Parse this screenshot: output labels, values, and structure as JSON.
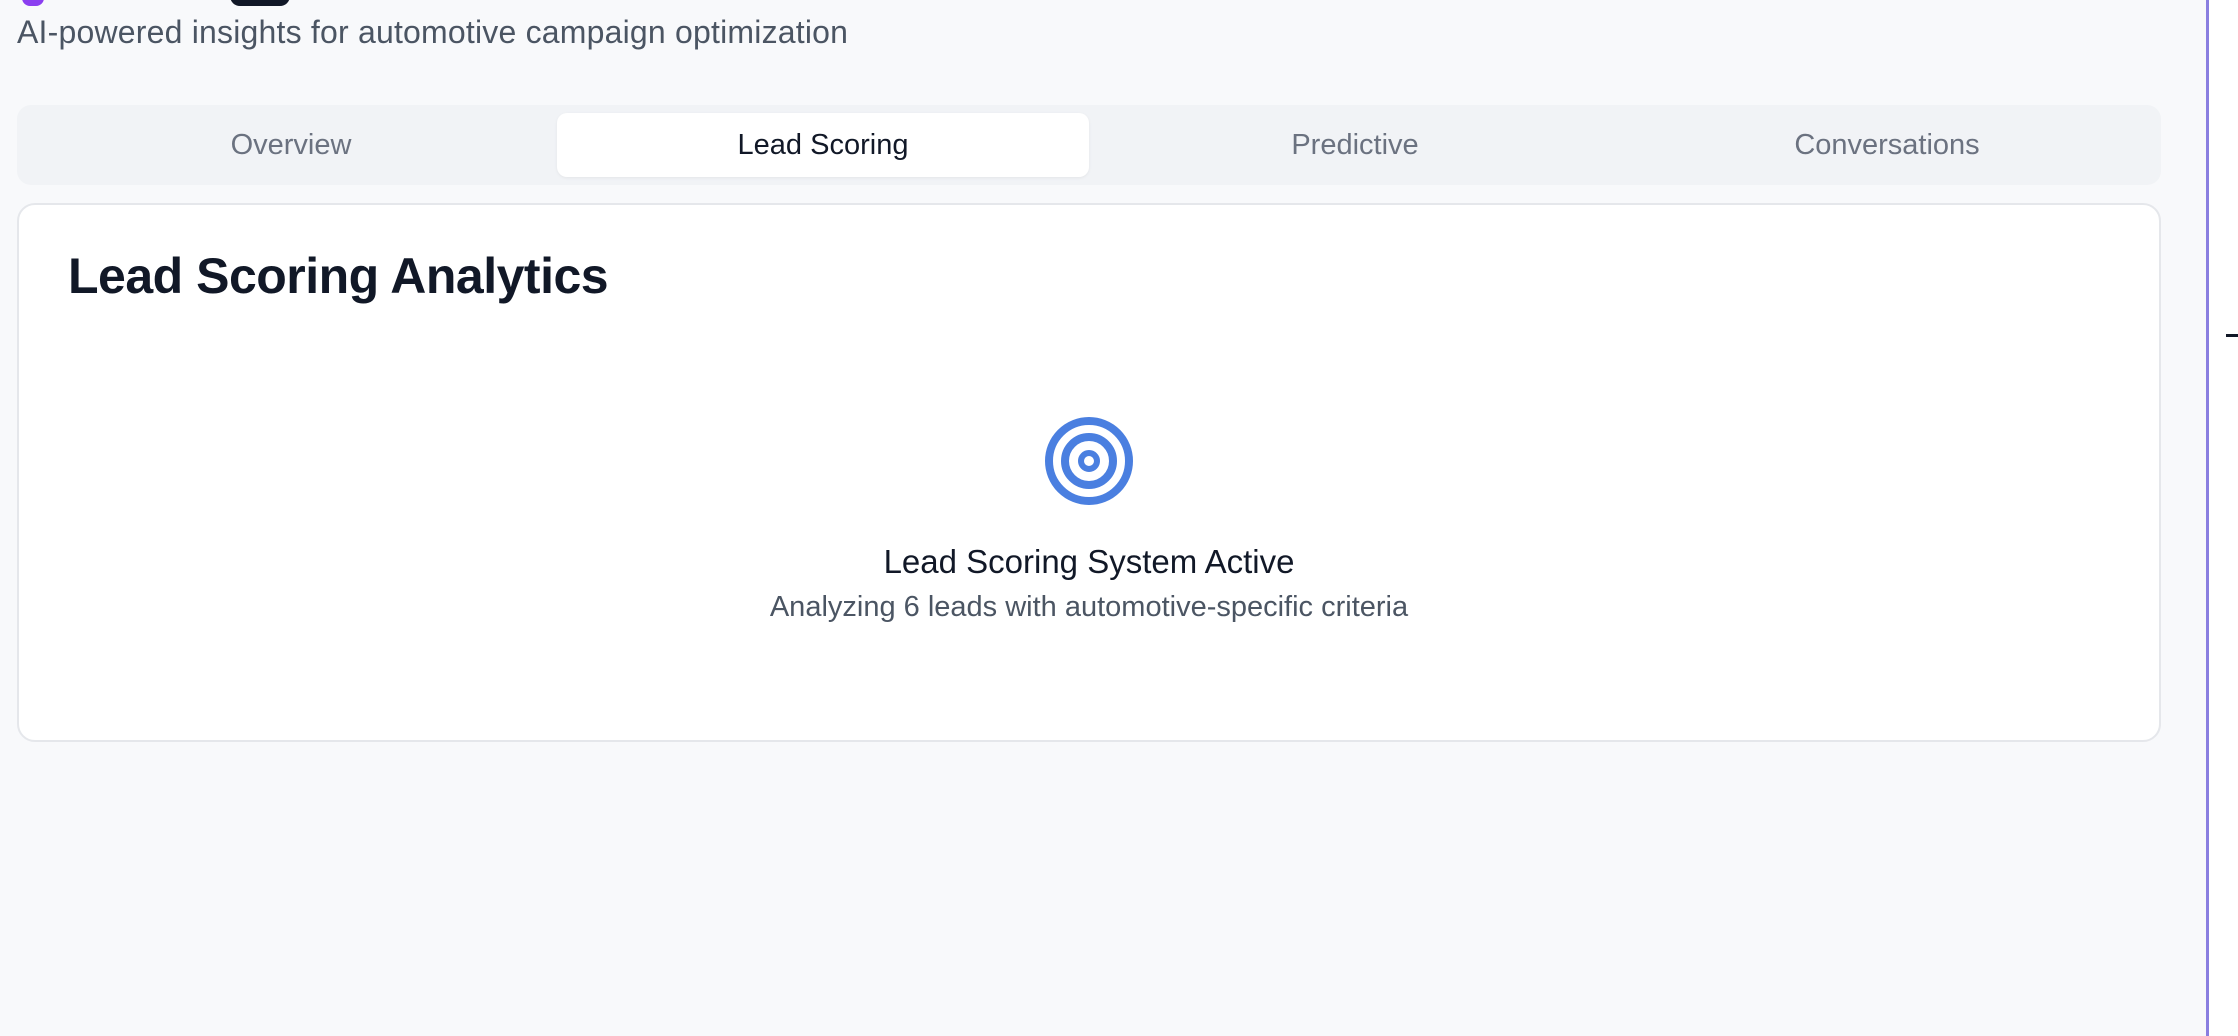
{
  "header": {
    "subtitle": "AI-powered insights for automotive campaign optimization"
  },
  "tabs": [
    {
      "label": "Overview",
      "active": false
    },
    {
      "label": "Lead Scoring",
      "active": true
    },
    {
      "label": "Predictive",
      "active": false
    },
    {
      "label": "Conversations",
      "active": false
    }
  ],
  "card": {
    "title": "Lead Scoring Analytics",
    "icon": "target-icon",
    "status_title": "Lead Scoring System Active",
    "status_description": "Analyzing 6 leads with automotive-specific criteria"
  },
  "colors": {
    "accent": "#4a7fe0",
    "brand": "#8b3ff0"
  }
}
